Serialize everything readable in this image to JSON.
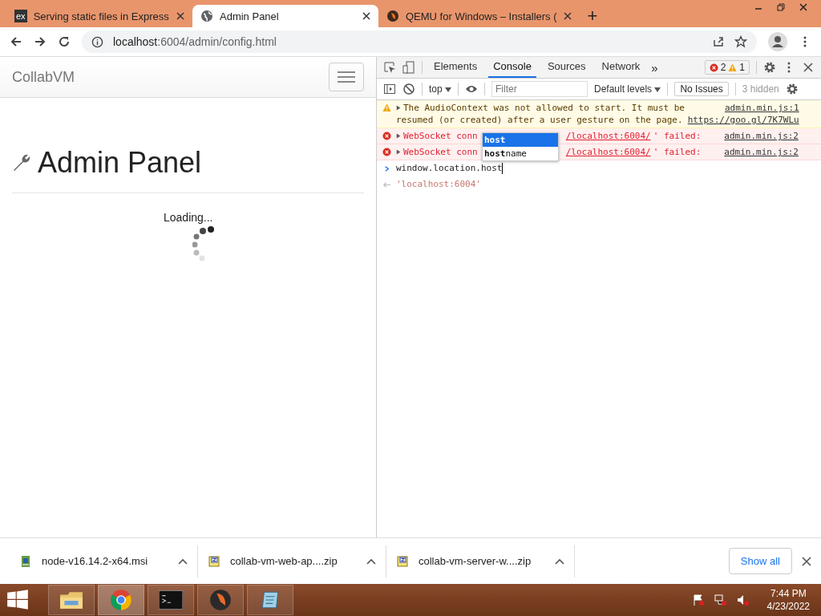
{
  "browser_tabs": [
    {
      "title": "Serving static files in Express",
      "favicon": "ex",
      "selected": false
    },
    {
      "title": "Admin Panel",
      "selected": true
    },
    {
      "title": "QEMU for Windows – Installers (",
      "selected": false
    }
  ],
  "new_tab_button": "+",
  "address_bar": {
    "host": "localhost",
    "rest": ":6004/admin/config.html"
  },
  "page": {
    "brand": "CollabVM",
    "heading": "Admin Panel",
    "loading": "Loading..."
  },
  "devtools": {
    "tabs": [
      {
        "label": "Elements",
        "selected": false
      },
      {
        "label": "Console",
        "selected": true
      },
      {
        "label": "Sources",
        "selected": false
      },
      {
        "label": "Network",
        "selected": false
      }
    ],
    "more_tabs": "»",
    "error_count": "2",
    "warning_count": "1",
    "context": "top",
    "filter": {
      "placeholder": "Filter"
    },
    "levels": "Default levels",
    "issues": "No Issues",
    "hidden": "3 hidden",
    "messages": [
      {
        "kind": "warning",
        "lines": [
          "The AudioContext was not allowed to start. It must be",
          "resumed (or created) after a user gesture on the page."
        ],
        "link": "https://goo.gl/7K7WLu",
        "source": "admin.min.js:1"
      },
      {
        "kind": "error",
        "prefix": "WebSocket conn",
        "suffix_link": "/localhost:6004/",
        "suffix": "' failed:",
        "source": "admin.min.js:2"
      },
      {
        "kind": "error",
        "prefix": "WebSocket conn",
        "suffix_link": "/localhost:6004/",
        "suffix": "' failed:",
        "source": "admin.min.js:2"
      }
    ],
    "input": "window.location.host",
    "result": "'localhost:6004'",
    "autocomplete": [
      {
        "label": "host",
        "selected": true
      },
      {
        "label": "**host**name",
        "selected": false
      }
    ]
  },
  "downloads": [
    {
      "name": "node-v16.14.2-x64.msi",
      "kind": "installer"
    },
    {
      "name": "collab-vm-web-ap....zip",
      "kind": "zip"
    },
    {
      "name": "collab-vm-server-w....zip",
      "kind": "zip"
    }
  ],
  "show_all": "Show all",
  "taskbar": {
    "time": "7:44 PM",
    "date": "4/23/2022"
  }
}
